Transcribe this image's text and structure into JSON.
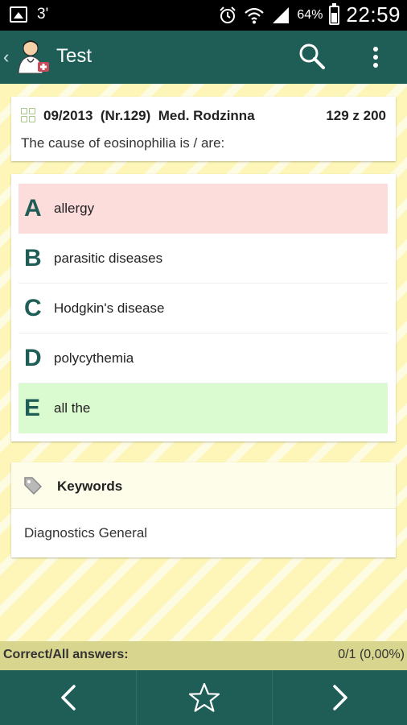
{
  "status_bar": {
    "notification_count": "3'",
    "battery": "64%",
    "time": "22:59"
  },
  "app_bar": {
    "title": "Test",
    "icons": [
      "back-chevron-icon",
      "doctor-logo-icon",
      "search-icon",
      "overflow-menu-icon"
    ]
  },
  "question": {
    "meta": "09/2013  (Nr.129)  Med. Rodzinna",
    "count": "129 z 200",
    "text": "The cause of eosinophilia is / are:"
  },
  "answers": [
    {
      "letter": "A",
      "text": "allergy",
      "state": "wrong"
    },
    {
      "letter": "B",
      "text": "parasitic diseases",
      "state": "none"
    },
    {
      "letter": "C",
      "text": "Hodgkin's disease",
      "state": "none"
    },
    {
      "letter": "D",
      "text": "polycythemia",
      "state": "none"
    },
    {
      "letter": "E",
      "text": "all the",
      "state": "correct"
    }
  ],
  "keywords": {
    "title": "Keywords",
    "value": "Diagnostics General"
  },
  "stats": {
    "label": "Correct/All answers:",
    "value": "0/1 (0,00%)"
  },
  "bottom_nav": {
    "icons": [
      "previous-chevron-icon",
      "favorite-star-icon",
      "next-chevron-icon"
    ]
  },
  "colors": {
    "primary": "#1f5e56",
    "wrong_answer_bg": "#fddcdc",
    "correct_answer_bg": "#dafbd0",
    "stats_bar_bg": "#d8d58e"
  }
}
